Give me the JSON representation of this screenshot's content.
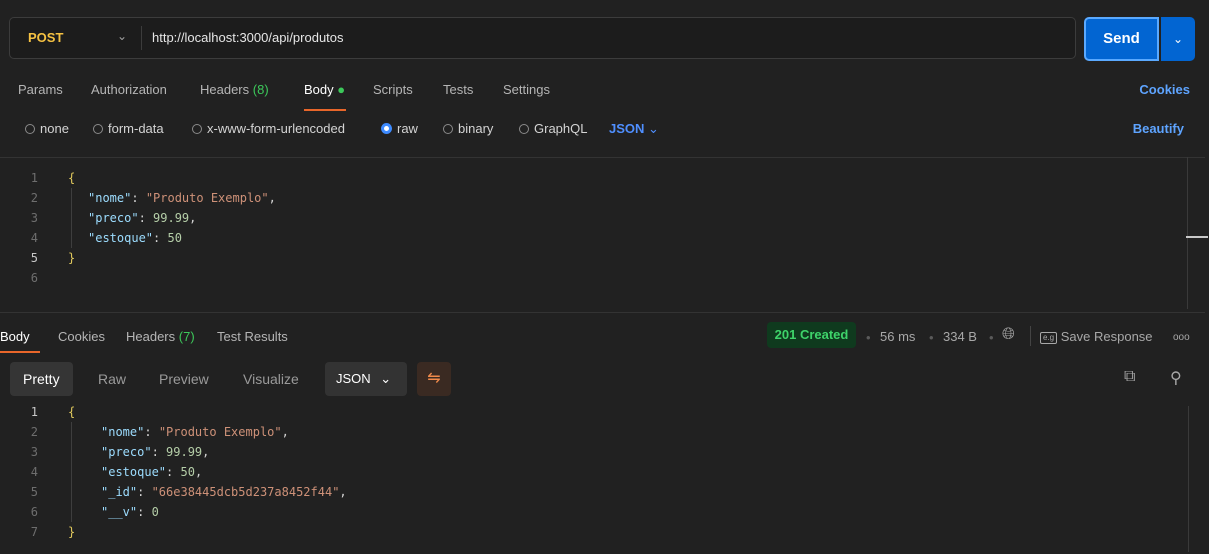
{
  "request": {
    "method": "POST",
    "url": "http://localhost:3000/api/produtos",
    "send_label": "Send"
  },
  "request_tabs": {
    "params": "Params",
    "authorization": "Authorization",
    "headers_label": "Headers",
    "headers_count": "(8)",
    "body": "Body",
    "scripts": "Scripts",
    "tests": "Tests",
    "settings": "Settings",
    "cookies": "Cookies"
  },
  "body_types": {
    "none": "none",
    "form_data": "form-data",
    "urlencoded": "x-www-form-urlencoded",
    "raw": "raw",
    "binary": "binary",
    "graphql": "GraphQL",
    "format": "JSON",
    "beautify": "Beautify",
    "selected": "raw"
  },
  "request_body": {
    "line_numbers": [
      "1",
      "2",
      "3",
      "4",
      "5",
      "6"
    ],
    "nome_key": "\"nome\"",
    "nome_val": "\"Produto Exemplo\"",
    "preco_key": "\"preco\"",
    "preco_val": "99.99",
    "estoque_key": "\"estoque\"",
    "estoque_val": "50"
  },
  "response_tabs": {
    "body": "Body",
    "cookies": "Cookies",
    "headers_label": "Headers",
    "headers_count": "(7)",
    "test_results": "Test Results"
  },
  "response_meta": {
    "status": "201 Created",
    "time": "56 ms",
    "size": "334 B",
    "save_response": "Save Response",
    "more": "ooo"
  },
  "response_view": {
    "pretty": "Pretty",
    "raw": "Raw",
    "preview": "Preview",
    "visualize": "Visualize",
    "format": "JSON"
  },
  "response_body": {
    "line_numbers": [
      "1",
      "2",
      "3",
      "4",
      "5",
      "6",
      "7"
    ],
    "nome_key": "\"nome\"",
    "nome_val": "\"Produto Exemplo\"",
    "preco_key": "\"preco\"",
    "preco_val": "99.99",
    "estoque_key": "\"estoque\"",
    "estoque_val": "50",
    "id_key": "\"_id\"",
    "id_val": "\"66e38445dcb5d237a8452f44\"",
    "v_key": "\"__v\"",
    "v_val": "0"
  },
  "colors": {
    "send": "#0265d2",
    "status_green": "#3ed36a",
    "accent_orange": "#e8662a",
    "link_blue": "#5ea4ff"
  }
}
